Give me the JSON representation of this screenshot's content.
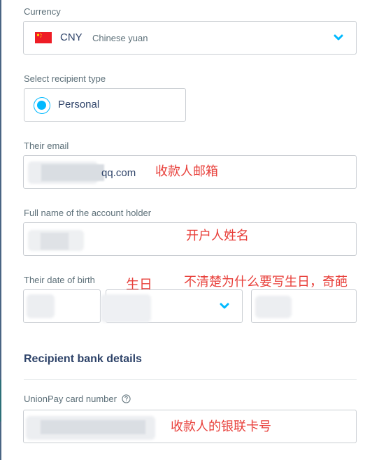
{
  "currency": {
    "label": "Currency",
    "code": "CNY",
    "name": "Chinese yuan",
    "flag_icon": "china-flag-icon",
    "dropdown_icon": "chevron-down-icon"
  },
  "recipient_type": {
    "label": "Select recipient type",
    "selected_option": "Personal"
  },
  "email": {
    "label": "Their email",
    "value_visible": "qq.com",
    "annotation": "收款人邮箱"
  },
  "full_name": {
    "label": "Full name of the account holder",
    "annotation": "开户人姓名"
  },
  "date_of_birth": {
    "label": "Their date of birth",
    "annotation_short": "生日",
    "annotation_long": "不清楚为什么要写生日，奇葩"
  },
  "bank_details": {
    "section_title": "Recipient bank details",
    "card_label": "UnionPay card number",
    "help_icon": "help-circle-icon",
    "annotation": "收款人的银联卡号"
  },
  "colors": {
    "accent": "#00b9ff",
    "annotation": "#e8403b",
    "label": "#5d7079",
    "heading": "#2e4369"
  }
}
